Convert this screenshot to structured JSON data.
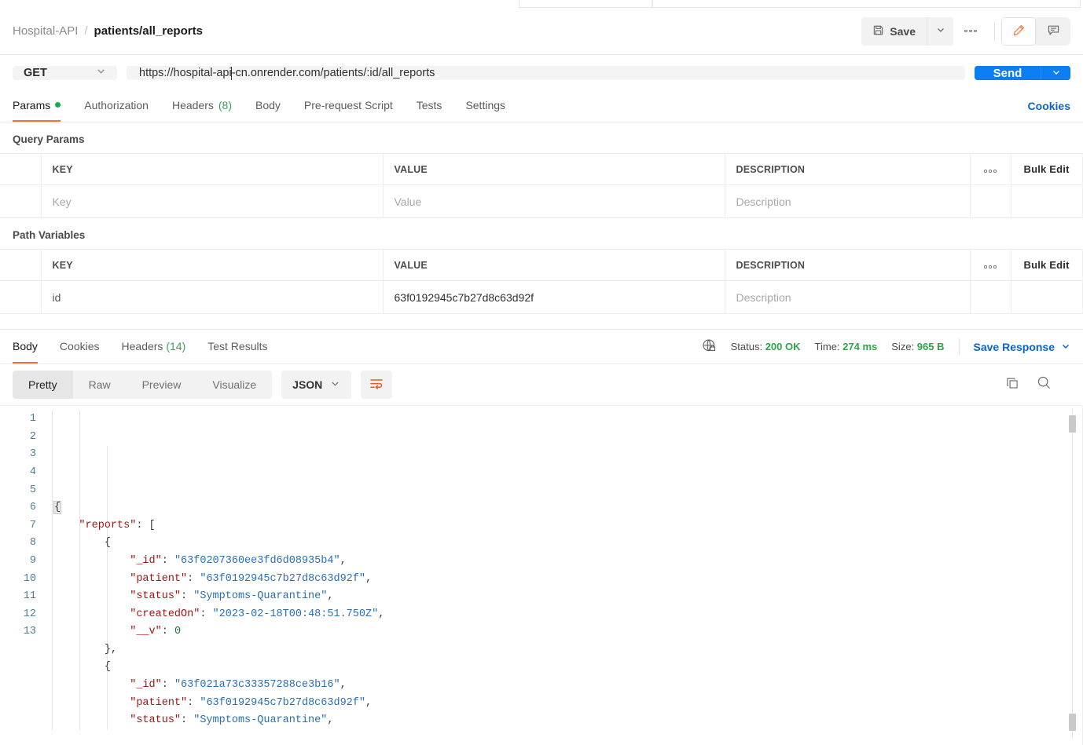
{
  "breadcrumb": {
    "collection": "Hospital-API",
    "separator": "/",
    "request_name": "patients/all_reports"
  },
  "toolbar": {
    "save_label": "Save",
    "save_icon": "floppy-disk-icon",
    "save_caret_icon": "chevron-down-icon",
    "more_icon": "ellipsis-icon",
    "edit_icon": "pencil-icon",
    "comment_icon": "comment-icon",
    "accent_orange": "#ff6c37"
  },
  "request": {
    "method": "GET",
    "method_caret_icon": "chevron-down-icon",
    "url_before_caret": "https://hospital-api",
    "url_after_caret": "-cn.onrender.com/patients/:id/all_reports",
    "url_full": "https://hospital-api-cn.onrender.com/patients/:id/all_reports",
    "send_label": "Send",
    "send_caret_icon": "chevron-down-icon",
    "send_color": "#0d7df2"
  },
  "request_tabs": [
    {
      "label": "Params",
      "badge": "",
      "dot": true,
      "active": true
    },
    {
      "label": "Authorization",
      "badge": "",
      "dot": false,
      "active": false
    },
    {
      "label": "Headers",
      "badge": "(8)",
      "dot": false,
      "active": false
    },
    {
      "label": "Body",
      "badge": "",
      "dot": false,
      "active": false
    },
    {
      "label": "Pre-request Script",
      "badge": "",
      "dot": false,
      "active": false
    },
    {
      "label": "Tests",
      "badge": "",
      "dot": false,
      "active": false
    },
    {
      "label": "Settings",
      "badge": "",
      "dot": false,
      "active": false
    }
  ],
  "cookies_link": "Cookies",
  "query_params": {
    "title": "Query Params",
    "headers": {
      "key": "KEY",
      "value": "VALUE",
      "description": "DESCRIPTION",
      "bulk_edit": "Bulk Edit"
    },
    "rows": [
      {
        "key": "Key",
        "value": "Value",
        "description": "Description",
        "placeholder": true
      }
    ]
  },
  "path_variables": {
    "title": "Path Variables",
    "headers": {
      "key": "KEY",
      "value": "VALUE",
      "description": "DESCRIPTION",
      "bulk_edit": "Bulk Edit"
    },
    "rows": [
      {
        "key": "id",
        "value": "63f0192945c7b27d8c63d92f",
        "description": "Description",
        "placeholder": false
      }
    ]
  },
  "response": {
    "tabs": [
      {
        "label": "Body",
        "badge": "",
        "active": true
      },
      {
        "label": "Cookies",
        "badge": "",
        "active": false
      },
      {
        "label": "Headers",
        "badge": "(14)",
        "active": false
      },
      {
        "label": "Test Results",
        "badge": "",
        "active": false
      }
    ],
    "network_icon": "globe-lock-icon",
    "status_label": "Status:",
    "status_value": "200 OK",
    "time_label": "Time:",
    "time_value": "274 ms",
    "size_label": "Size:",
    "size_value": "965 B",
    "save_response": "Save Response",
    "save_response_caret_icon": "chevron-down-icon",
    "status_color": "#2fa349",
    "view_modes": [
      {
        "label": "Pretty",
        "active": true
      },
      {
        "label": "Raw",
        "active": false
      },
      {
        "label": "Preview",
        "active": false
      },
      {
        "label": "Visualize",
        "active": false
      }
    ],
    "format": "JSON",
    "format_caret_icon": "chevron-down-icon",
    "wrap_icon": "word-wrap-icon",
    "copy_icon": "copy-icon",
    "search_icon": "search-icon"
  },
  "body_code": {
    "language": "json",
    "lines": [
      {
        "n": 1,
        "indent": 0,
        "tokens": [
          {
            "t": "pun",
            "v": "{"
          }
        ]
      },
      {
        "n": 2,
        "indent": 1,
        "tokens": [
          {
            "t": "key",
            "v": "\"reports\""
          },
          {
            "t": "pun",
            "v": ": ["
          }
        ]
      },
      {
        "n": 3,
        "indent": 2,
        "tokens": [
          {
            "t": "pun",
            "v": "{"
          }
        ]
      },
      {
        "n": 4,
        "indent": 3,
        "tokens": [
          {
            "t": "key",
            "v": "\"_id\""
          },
          {
            "t": "pun",
            "v": ": "
          },
          {
            "t": "str",
            "v": "\"63f0207360ee3fd6d08935b4\""
          },
          {
            "t": "pun",
            "v": ","
          }
        ]
      },
      {
        "n": 5,
        "indent": 3,
        "tokens": [
          {
            "t": "key",
            "v": "\"patient\""
          },
          {
            "t": "pun",
            "v": ": "
          },
          {
            "t": "str",
            "v": "\"63f0192945c7b27d8c63d92f\""
          },
          {
            "t": "pun",
            "v": ","
          }
        ]
      },
      {
        "n": 6,
        "indent": 3,
        "tokens": [
          {
            "t": "key",
            "v": "\"status\""
          },
          {
            "t": "pun",
            "v": ": "
          },
          {
            "t": "str",
            "v": "\"Symptoms-Quarantine\""
          },
          {
            "t": "pun",
            "v": ","
          }
        ]
      },
      {
        "n": 7,
        "indent": 3,
        "tokens": [
          {
            "t": "key",
            "v": "\"createdOn\""
          },
          {
            "t": "pun",
            "v": ": "
          },
          {
            "t": "str",
            "v": "\"2023-02-18T00:48:51.750Z\""
          },
          {
            "t": "pun",
            "v": ","
          }
        ]
      },
      {
        "n": 8,
        "indent": 3,
        "tokens": [
          {
            "t": "key",
            "v": "\"__v\""
          },
          {
            "t": "pun",
            "v": ": "
          },
          {
            "t": "num",
            "v": "0"
          }
        ]
      },
      {
        "n": 9,
        "indent": 2,
        "tokens": [
          {
            "t": "pun",
            "v": "},"
          }
        ]
      },
      {
        "n": 10,
        "indent": 2,
        "tokens": [
          {
            "t": "pun",
            "v": "{"
          }
        ]
      },
      {
        "n": 11,
        "indent": 3,
        "tokens": [
          {
            "t": "key",
            "v": "\"_id\""
          },
          {
            "t": "pun",
            "v": ": "
          },
          {
            "t": "str",
            "v": "\"63f021a73c33357288ce3b16\""
          },
          {
            "t": "pun",
            "v": ","
          }
        ]
      },
      {
        "n": 12,
        "indent": 3,
        "tokens": [
          {
            "t": "key",
            "v": "\"patient\""
          },
          {
            "t": "pun",
            "v": ": "
          },
          {
            "t": "str",
            "v": "\"63f0192945c7b27d8c63d92f\""
          },
          {
            "t": "pun",
            "v": ","
          }
        ]
      },
      {
        "n": 13,
        "indent": 3,
        "tokens": [
          {
            "t": "key",
            "v": "\"status\""
          },
          {
            "t": "pun",
            "v": ": "
          },
          {
            "t": "str",
            "v": "\"Symptoms-Quarantine\""
          },
          {
            "t": "pun",
            "v": ","
          }
        ]
      }
    ]
  }
}
